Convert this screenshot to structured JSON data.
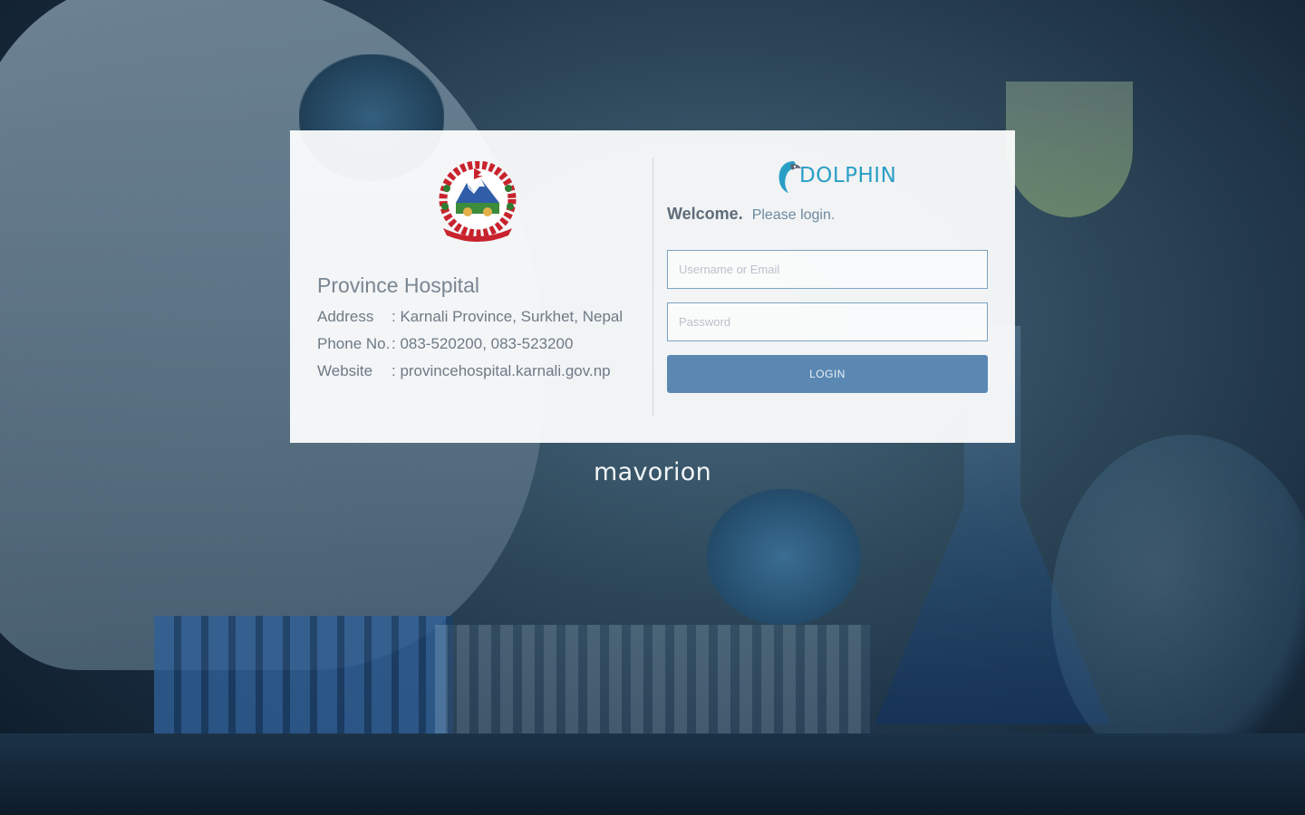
{
  "hospital": {
    "name": "Province Hospital",
    "address_label": "Address",
    "address_value": ": Karnali Province, Surkhet, Nepal",
    "phone_label": "Phone No.",
    "phone_value": ": 083-520200, 083-523200",
    "website_label": "Website",
    "website_value": ": provincehospital.karnali.gov.np",
    "emblem_icon": "nepal-emblem-icon"
  },
  "login": {
    "brand": "DOLPHIN",
    "brand_icon": "dolphin-icon",
    "welcome": "Welcome.",
    "subtitle": "Please login.",
    "username_placeholder": "Username or Email",
    "password_placeholder": "Password",
    "button_label": "LOGIN"
  },
  "footer": {
    "brand": "mavorion"
  },
  "colors": {
    "accent": "#2a9fc6",
    "button": "#5b88b3",
    "input_border": "#7aa3c3"
  }
}
